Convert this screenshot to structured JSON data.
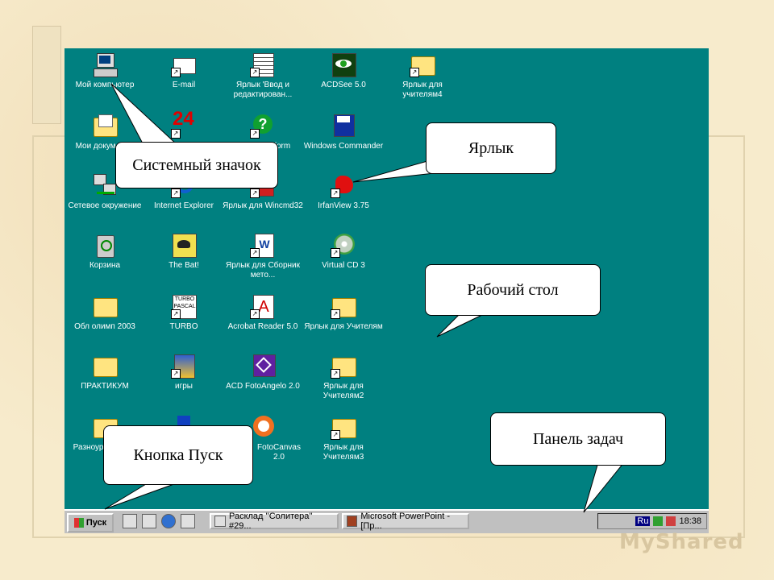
{
  "desktop_icons": [
    {
      "label": "Мой компьютер",
      "icon": "my-computer-icon"
    },
    {
      "label": "Мои документы",
      "icon": "my-documents-icon"
    },
    {
      "label": "Сетевое окружение",
      "icon": "network-icon"
    },
    {
      "label": "Корзина",
      "icon": "recycle-bin-icon"
    },
    {
      "label": "Обл олимп 2003",
      "icon": "folder-icon"
    },
    {
      "label": "ПРАКТИКУМ",
      "icon": "folder-icon"
    },
    {
      "label": "Разноур задания",
      "icon": "folder-icon"
    },
    {
      "label": "E-mail",
      "icon": "mail-icon"
    },
    {
      "label": "24",
      "icon": "program-24-icon"
    },
    {
      "label": "Internet Explorer",
      "icon": "ie-icon"
    },
    {
      "label": "The Bat!",
      "icon": "thebat-icon"
    },
    {
      "label": "TURBO",
      "icon": "turbo-pascal-icon"
    },
    {
      "label": "игры",
      "icon": "games-icon"
    },
    {
      "label": "",
      "icon": "program-icon"
    },
    {
      "label": "Ярлык 'Ввод и редактирован...",
      "icon": "document-icon"
    },
    {
      "label": "Inform",
      "icon": "help-icon"
    },
    {
      "label": "Ярлык для Wincmd32",
      "icon": "wincmd-icon"
    },
    {
      "label": "Ярлык для Сборник мето...",
      "icon": "word-doc-icon"
    },
    {
      "label": "Acrobat Reader 5.0",
      "icon": "acrobat-icon"
    },
    {
      "label": "ACD FotoAngelo 2.0",
      "icon": "fotoangelo-icon"
    },
    {
      "label": "FotoCanvas 2.0",
      "icon": "fotocanvas-icon"
    },
    {
      "label": "ACDSee 5.0",
      "icon": "acdsee-icon"
    },
    {
      "label": "Windows Commander",
      "icon": "windows-commander-icon"
    },
    {
      "label": "IrfanView 3.75",
      "icon": "irfanview-icon"
    },
    {
      "label": "Virtual CD 3",
      "icon": "virtual-cd-icon"
    },
    {
      "label": "Ярлык для Учителям",
      "icon": "folder-icon"
    },
    {
      "label": "Ярлык для Учителям2",
      "icon": "folder-icon"
    },
    {
      "label": "Ярлык для Учителям3",
      "icon": "folder-icon"
    },
    {
      "label": "Ярлык для учителям4",
      "icon": "folder-icon"
    }
  ],
  "taskbar": {
    "start_label": "Пуск",
    "tasks": [
      {
        "label": "Расклад ''Солитера'' #29..."
      },
      {
        "label": "Microsoft PowerPoint - [Пр..."
      }
    ],
    "tray_lang": "Ru",
    "clock": "18:38"
  },
  "callouts": {
    "system_icon": "Системный значок",
    "shortcut": "Ярлык",
    "desktop": "Рабочий стол",
    "start_button": "Кнопка Пуск",
    "taskbar": "Панель задач"
  },
  "watermark": "MyShared"
}
